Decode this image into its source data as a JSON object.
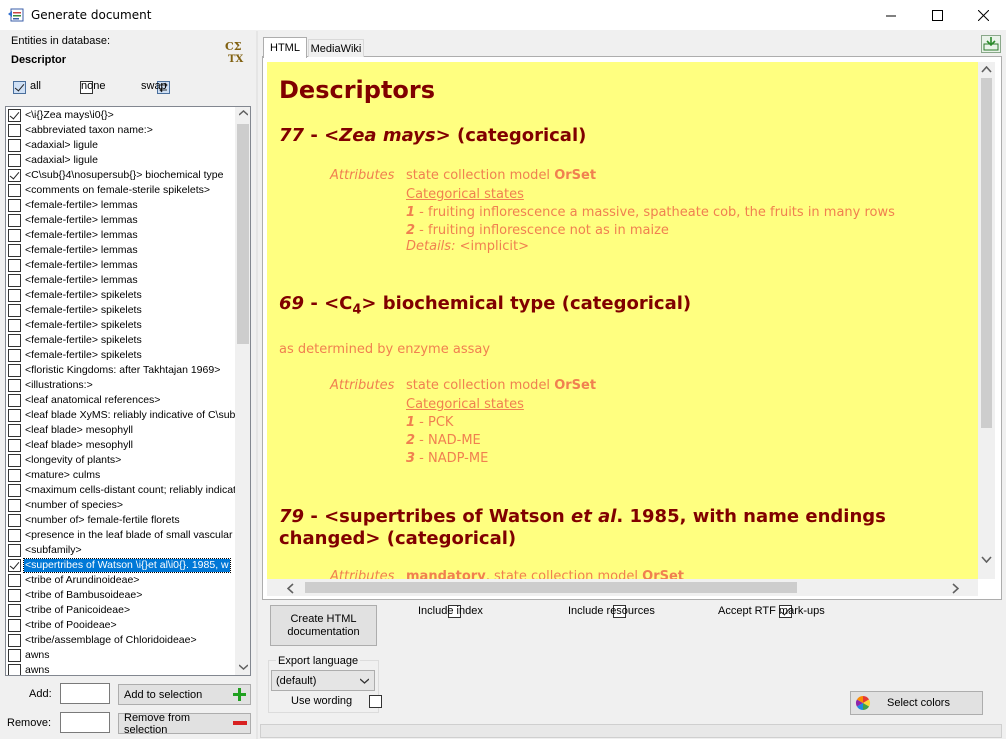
{
  "window": {
    "title": "Generate document",
    "minimize_glyph": "—",
    "maximize_glyph": "☐",
    "close_glyph": "✕"
  },
  "left": {
    "entities_label": "Entities in database:",
    "entity_type": "Descriptor",
    "all_label": "all",
    "none_label": "none",
    "swap_label": "swap",
    "items": [
      {
        "text": "<\\i{}Zea mays\\i0{}>",
        "checked": true
      },
      {
        "text": "<abbreviated taxon name:>",
        "checked": false
      },
      {
        "text": "<adaxial> ligule",
        "checked": false
      },
      {
        "text": "<adaxial> ligule",
        "checked": false
      },
      {
        "text": "<C\\sub{}4\\nosupersub{}> biochemical type",
        "checked": true
      },
      {
        "text": "<comments on female-sterile spikelets>",
        "checked": false
      },
      {
        "text": "<female-fertile> lemmas",
        "checked": false
      },
      {
        "text": "<female-fertile> lemmas",
        "checked": false
      },
      {
        "text": "<female-fertile> lemmas",
        "checked": false
      },
      {
        "text": "<female-fertile> lemmas",
        "checked": false
      },
      {
        "text": "<female-fertile> lemmas",
        "checked": false
      },
      {
        "text": "<female-fertile> lemmas",
        "checked": false
      },
      {
        "text": "<female-fertile> spikelets",
        "checked": false
      },
      {
        "text": "<female-fertile> spikelets",
        "checked": false
      },
      {
        "text": "<female-fertile> spikelets",
        "checked": false
      },
      {
        "text": "<female-fertile> spikelets",
        "checked": false
      },
      {
        "text": "<female-fertile> spikelets",
        "checked": false
      },
      {
        "text": "<floristic Kingdoms: after Takhtajan 1969>",
        "checked": false
      },
      {
        "text": "<illustrations:>",
        "checked": false
      },
      {
        "text": "<leaf anatomical references>",
        "checked": false
      },
      {
        "text": "<leaf blade XyMS: reliably indicative of C\\sub",
        "checked": false
      },
      {
        "text": "<leaf blade> mesophyll",
        "checked": false
      },
      {
        "text": "<leaf blade> mesophyll",
        "checked": false
      },
      {
        "text": "<longevity of plants>",
        "checked": false
      },
      {
        "text": "<mature> culms",
        "checked": false
      },
      {
        "text": "<maximum cells-distant count; reliably indicat",
        "checked": false
      },
      {
        "text": "<number of species>",
        "checked": false
      },
      {
        "text": "<number of> female-fertile florets",
        "checked": false
      },
      {
        "text": "<presence in the leaf blade of small vascular",
        "checked": false
      },
      {
        "text": "<subfamily>",
        "checked": false
      },
      {
        "text": "<supertribes of Watson \\i{}et al\\i0{}. 1985, w",
        "checked": true,
        "selected": true
      },
      {
        "text": "<tribe of Arundinoideae>",
        "checked": false
      },
      {
        "text": "<tribe of Bambusoideae>",
        "checked": false
      },
      {
        "text": "<tribe of Panicoideae>",
        "checked": false
      },
      {
        "text": "<tribe of Pooideae>",
        "checked": false
      },
      {
        "text": "<tribe/assemblage of Chloridoideae>",
        "checked": false
      },
      {
        "text": "awns",
        "checked": false
      },
      {
        "text": "awns",
        "checked": false
      }
    ],
    "add_label": "Add:",
    "add_button": "Add to selection",
    "remove_label": "Remove:",
    "remove_button": "Remove from selection"
  },
  "tabs": [
    {
      "label": "HTML",
      "active": true
    },
    {
      "label": "MediaWiki",
      "active": false
    }
  ],
  "document": {
    "heading": "Descriptors",
    "d1": {
      "num": "77",
      "dash": " - ",
      "name": "<Zea mays>",
      "type": " (categorical)",
      "attr_label": "Attributes",
      "attr_text": "state collection model ",
      "attr_model": "OrSet",
      "states_label": "Categorical states",
      "states": [
        {
          "n": "1",
          "text": " - fruiting inflorescence a massive, spatheate cob, the fruits in many rows"
        },
        {
          "n": "2",
          "text": " - fruiting inflorescence not as in maize"
        }
      ],
      "details_label": "Details:",
      "details_text": "<implicit>"
    },
    "d2": {
      "num": "69",
      "dash": " - ",
      "name_pre": "<C",
      "name_sub": "4",
      "name_post": "> biochemical type (categorical)",
      "note": "as determined by enzyme assay",
      "attr_label": "Attributes",
      "attr_text": "state collection model ",
      "attr_model": "OrSet",
      "states_label": "Categorical states",
      "states": [
        {
          "n": "1",
          "text": " - PCK"
        },
        {
          "n": "2",
          "text": " - NAD-ME"
        },
        {
          "n": "3",
          "text": " - NADP-ME"
        }
      ]
    },
    "d3": {
      "num": "79",
      "dash": " - ",
      "line1_pre": "<supertribes of Watson ",
      "line1_em": "et al",
      "line1_post": ". 1985, with name endings",
      "line2": "changed> (categorical)",
      "attr_label": "Attributes",
      "attr_mandatory": "mandatory",
      "attr_text": ", state collection model ",
      "attr_model": "OrSet"
    }
  },
  "bottom": {
    "create_button_line1": "Create HTML",
    "create_button_line2": "documentation",
    "include_index": {
      "label": "Include index",
      "checked": false
    },
    "include_resources": {
      "label": "Include resources",
      "checked": false
    },
    "accept_rtf": {
      "label": "Accept RTF mark-ups",
      "checked": true
    },
    "export_language_label": "Export language",
    "export_language_value": "(default)",
    "use_wording": {
      "label": "Use wording",
      "checked": false
    },
    "select_colors": "Select colors"
  },
  "colors": {
    "doc_background": "#ffff80",
    "heading": "#800000",
    "body_text": "#f08050",
    "selection": "#0078d7"
  }
}
